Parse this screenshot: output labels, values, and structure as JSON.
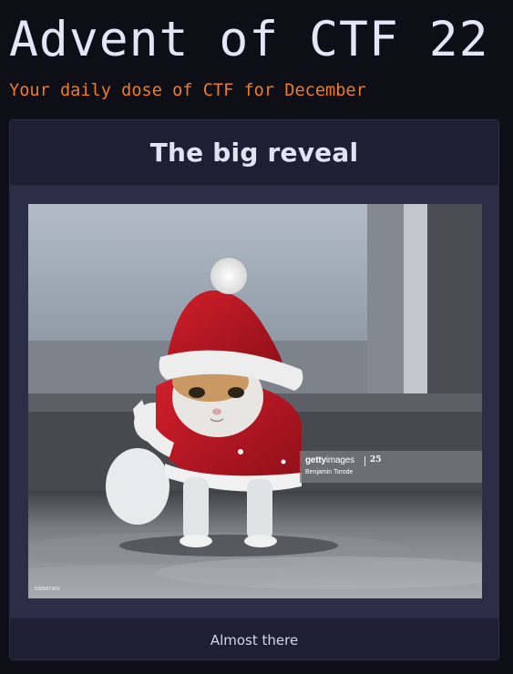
{
  "site": {
    "title": "Advent of CTF 22",
    "subtitle": "Your daily dose of CTF for December"
  },
  "card": {
    "title": "The big reveal",
    "footer": "Almost there",
    "image": {
      "watermark_brand_bold": "getty",
      "watermark_brand_thin": "images",
      "watermark_badge": "25",
      "watermark_credit": "Benjamin Torode",
      "image_id": "530587905"
    }
  },
  "colors": {
    "background": "#0e0e17",
    "title": "#e6e4f7",
    "subtitle_accent": "#ee7b27",
    "card_header": "#1e1f34",
    "card_body": "#2c2d46"
  }
}
